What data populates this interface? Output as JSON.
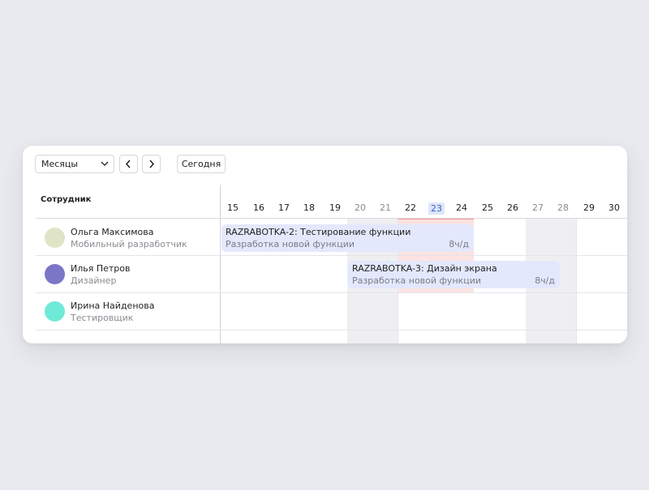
{
  "toolbar": {
    "scale_select": "Месяцы",
    "prev_icon": "chevron-left-icon",
    "next_icon": "chevron-right-icon",
    "today_label": "Сегодня"
  },
  "table": {
    "employee_header": "Сотрудник",
    "days": [
      "15",
      "16",
      "17",
      "18",
      "19",
      "20",
      "21",
      "22",
      "23",
      "24",
      "25",
      "26",
      "27",
      "28",
      "29",
      "30"
    ],
    "today": "23"
  },
  "employees": [
    {
      "name": "Ольга Максимова",
      "role": "Мобильный разработчик",
      "avatar_color": "#dfe4c7"
    },
    {
      "name": "Илья Петров",
      "role": "Дизайнер",
      "avatar_color": "#7b76c6"
    },
    {
      "name": "Ирина Найденова",
      "role": "Тестировщик",
      "avatar_color": "#70ead8"
    }
  ],
  "tasks": [
    {
      "title": "RAZRABOTKA-2: Тестирование функции",
      "subtitle": "Разработка новой функции",
      "hours": "8ч/д"
    },
    {
      "title": "RAZRABOTKA-3: Дизайн экрана",
      "subtitle": "Разработка новой функции",
      "hours": "8ч/д"
    }
  ],
  "colors": {
    "background": "#e9eaef",
    "task_bg": "#e3e8fc",
    "today_highlight": "#dfe6fa",
    "today_column": "#fbe3e1",
    "weekend_column": "#efeff2"
  }
}
